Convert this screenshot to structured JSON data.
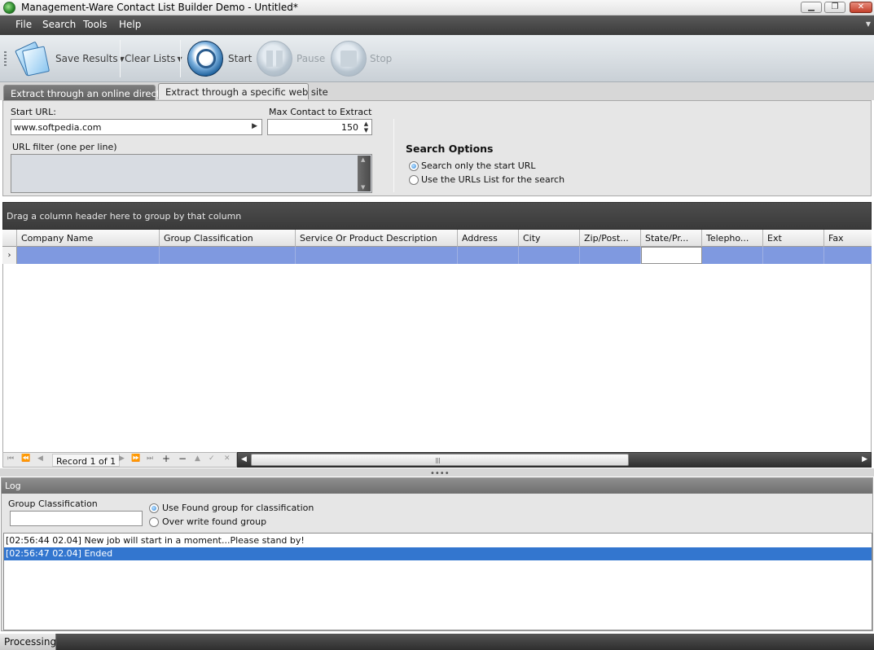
{
  "window": {
    "title": "Management-Ware Contact List Builder Demo - Untitled*",
    "minimize_glyph": "▁",
    "maximize_glyph": "❐",
    "close_glyph": "✕"
  },
  "menu": {
    "items": [
      "File",
      "Search",
      "Tools",
      "Help"
    ]
  },
  "toolbar": {
    "save_results": "Save Results",
    "clear_lists": "Clear Lists",
    "start": "Start",
    "pause": "Pause",
    "stop": "Stop"
  },
  "tabs": [
    {
      "label": "Extract through an online directory",
      "active": false
    },
    {
      "label": "Extract through a specific web site",
      "active": true
    }
  ],
  "form": {
    "start_url_label": "Start URL:",
    "start_url_value": "www.softpedia.com",
    "max_contact_label": "Max Contact to Extract",
    "max_contact_value": "150",
    "url_filter_label": "URL filter (one per line)",
    "search_options_title": "Search Options",
    "options": [
      {
        "label": "Search only the start URL",
        "selected": true
      },
      {
        "label": "Use the URLs List for the search",
        "selected": false
      }
    ]
  },
  "grid": {
    "group_prompt": "Drag a column header here to group by that column",
    "columns": [
      "Company Name",
      "Group Classification",
      "Service Or Product Description",
      "Address",
      "City",
      "Zip/Post...",
      "State/Pr...",
      "Telepho...",
      "Ext",
      "Fax"
    ],
    "row_indicator": "›",
    "record_text": "Record 1 of 1",
    "selected_row_color": "#7f99e0"
  },
  "log": {
    "header": "Log",
    "group_classification_label": "Group Classification",
    "group_classification_value": "",
    "options": [
      {
        "label": "Use Found group for classification",
        "selected": true
      },
      {
        "label": "Over write found group",
        "selected": false
      }
    ],
    "lines": [
      {
        "text": "[02:56:44 02.04] New job will start in a moment...Please stand by!",
        "selected": false
      },
      {
        "text": "[02:56:47 02.04] Ended",
        "selected": true
      }
    ]
  },
  "status": {
    "text": "Processing"
  }
}
